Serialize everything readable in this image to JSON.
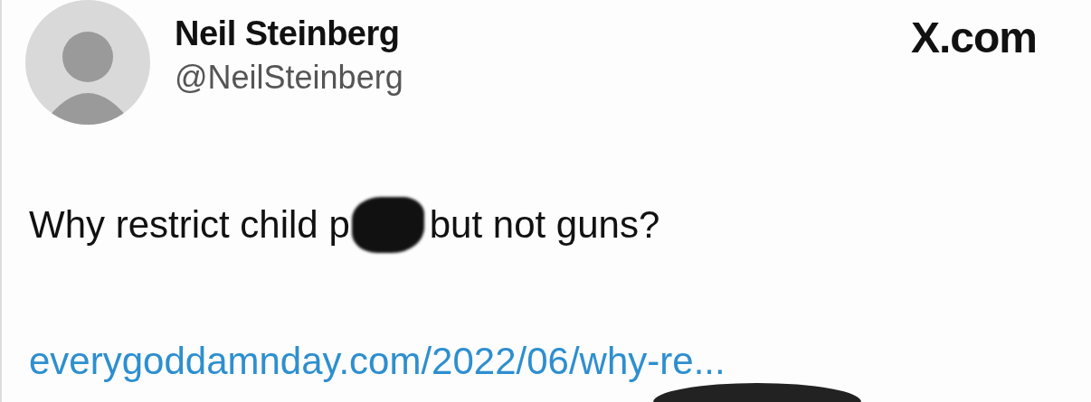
{
  "author": {
    "name": "Neil Steinberg",
    "handle": "@NeilSteinberg"
  },
  "source": "X.com",
  "tweet": {
    "segments": [
      {
        "kind": "text",
        "text": "Why restrict child p"
      },
      {
        "kind": "redaction"
      },
      {
        "kind": "text",
        "text": "but not guns?"
      }
    ],
    "link": "everygoddamnday.com/2022/06/why-re..."
  }
}
